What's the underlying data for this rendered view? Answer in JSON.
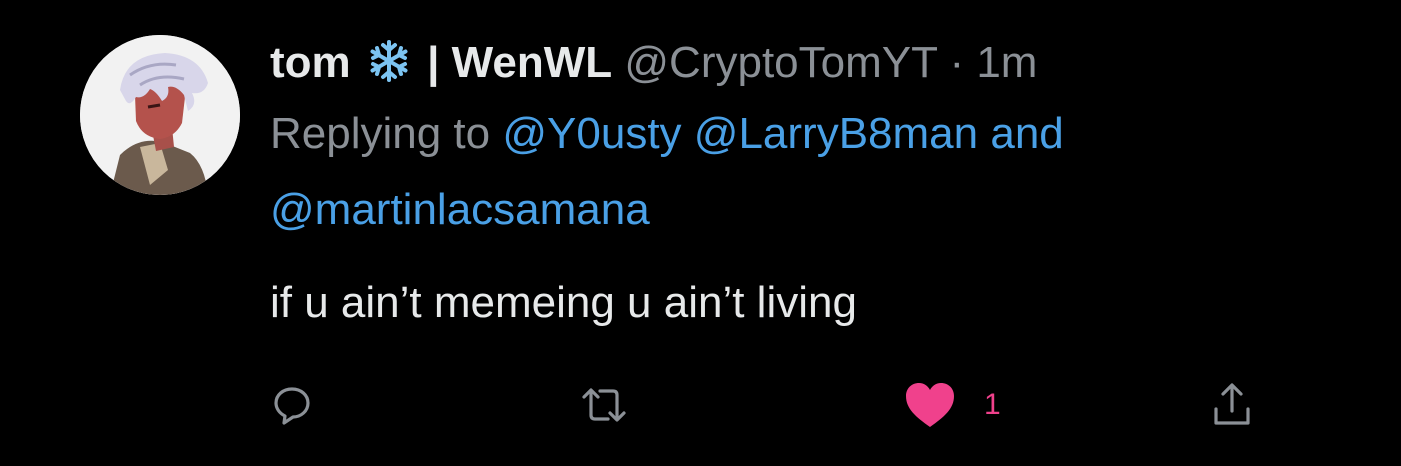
{
  "tweet": {
    "display_name": "tom",
    "name_suffix": "| WenWL",
    "handle": "@CryptoTomYT",
    "separator": "·",
    "time": "1m",
    "replying_to_label": "Replying to",
    "mentions": [
      "@Y0usty",
      "@LarryB8man"
    ],
    "and_word": "and",
    "mention_last": "@martinlacsamana",
    "text": "if u ain’t memeing u ain’t living"
  },
  "actions": {
    "reply_icon": "reply-icon",
    "retweet_icon": "retweet-icon",
    "like_icon": "heart-icon",
    "like_count": "1",
    "share_icon": "share-icon"
  },
  "colors": {
    "background": "#000000",
    "text": "#e7e9ea",
    "secondary": "#8b9096",
    "link": "#4aa0e6",
    "like": "#f0418c"
  }
}
